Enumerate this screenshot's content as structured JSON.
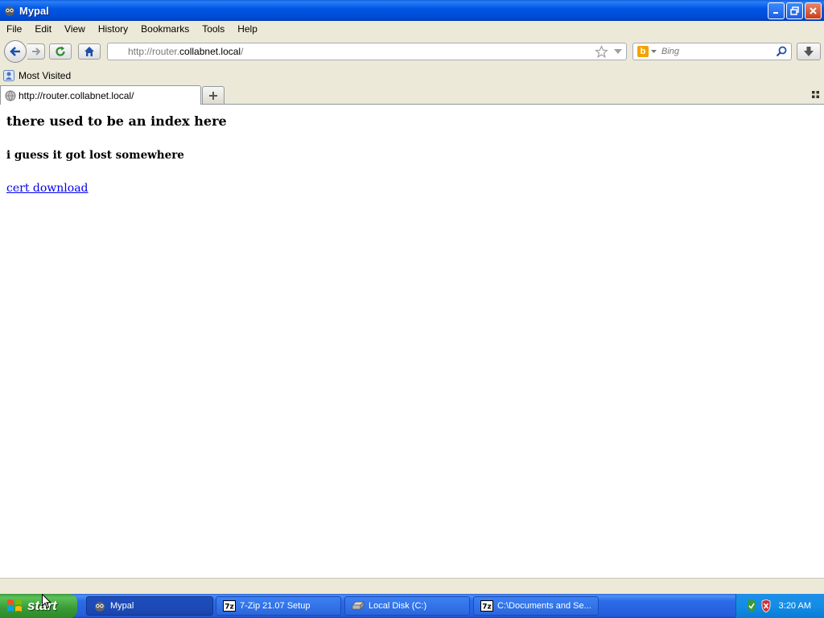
{
  "window": {
    "title": "Mypal"
  },
  "menu": [
    "File",
    "Edit",
    "View",
    "History",
    "Bookmarks",
    "Tools",
    "Help"
  ],
  "urlbar": {
    "proto": "http://router.",
    "host": "collabnet.local",
    "path": "/"
  },
  "search": {
    "placeholder": "Bing",
    "engine": "bing-icon"
  },
  "bookmarks": {
    "most_visited": "Most Visited"
  },
  "tab": {
    "title": "http://router.collabnet.local/"
  },
  "page": {
    "heading": "there used to be an index here",
    "subheading": "i guess it got lost somewhere",
    "link": "cert download"
  },
  "taskbar": {
    "start": "start",
    "tasks": [
      "Mypal",
      "7-Zip 21.07 Setup",
      "Local Disk (C:)",
      "C:\\Documents and Se..."
    ],
    "clock": "3:20 AM"
  },
  "colors": {
    "titlebar": "#0058e6",
    "chrome": "#ece9d8",
    "link": "#0000ee",
    "taskbar": "#245ddb",
    "start": "#3c9a38"
  }
}
